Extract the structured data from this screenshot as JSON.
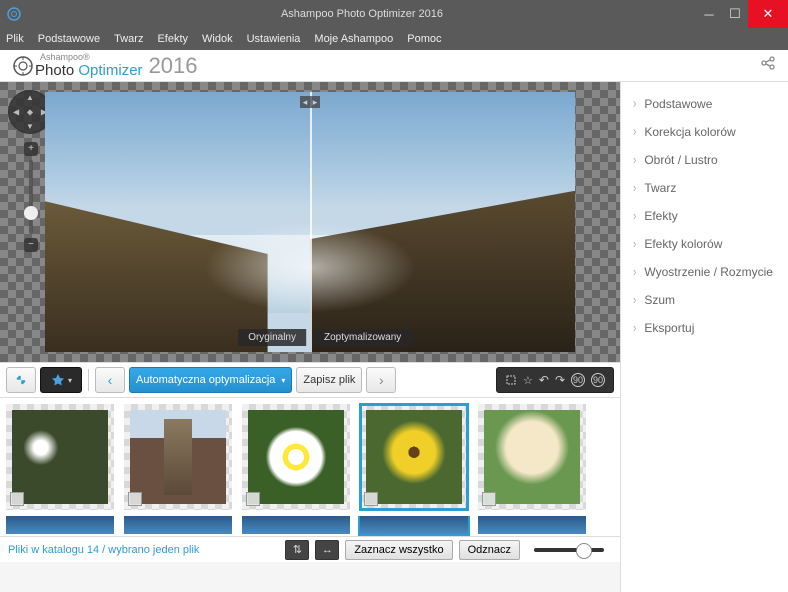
{
  "window": {
    "title": "Ashampoo Photo Optimizer 2016"
  },
  "menu": [
    "Plik",
    "Podstawowe",
    "Twarz",
    "Efekty",
    "Widok",
    "Ustawienia",
    "Moje Ashampoo",
    "Pomoc"
  ],
  "logo": {
    "brand": "Ashampoo®",
    "prefix": "Photo ",
    "highlight": "Optimizer",
    "year": "2016"
  },
  "compare": {
    "left": "Oryginalny",
    "right": "Zoptymalizowany"
  },
  "toolbar": {
    "optimize": "Automatyczna optymalizacja",
    "save": "Zapisz plik"
  },
  "categories": [
    "Podstawowe",
    "Korekcja kolorów",
    "Obrót / Lustro",
    "Twarz",
    "Efekty",
    "Efekty kolorów",
    "Wyostrzenie / Rozmycie",
    "Szum",
    "Eksportuj"
  ],
  "status": {
    "text": "Pliki w katalogu 14 / wybrano jeden plik",
    "selectAll": "Zaznacz wszystko",
    "deselect": "Odznacz"
  }
}
